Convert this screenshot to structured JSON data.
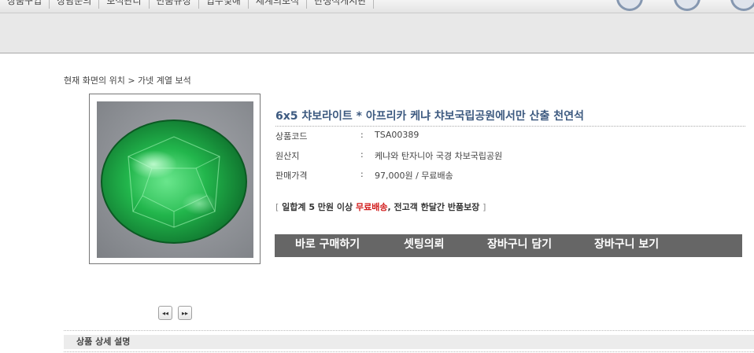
{
  "nav": {
    "items": [
      "상품구입",
      "상담문의",
      "보석관리",
      "반품규정",
      "입수및해",
      "세계의보석",
      "탄생석게시판"
    ]
  },
  "breadcrumb": "현재 화면의 위치 > 가넷 계열 보석",
  "product": {
    "title": "6x5 챠보라이트 * 아프리카 케냐 챠보국립공원에서만 산출 천연석",
    "fields": [
      {
        "label": "상품코드",
        "colon": ":",
        "value": "TSA00389"
      },
      {
        "label": "원산지",
        "colon": ":",
        "value": "케냐와 탄자니아 국경 차보국립공원"
      },
      {
        "label": "판매가격",
        "colon": ":",
        "value": "97,000원 / 무료배송"
      }
    ],
    "notice": {
      "open": "[",
      "part1": " 일합계 5 만원 이상 ",
      "free": "무료배송",
      "part2": ",   전고객 한달간 반품보장 ",
      "close": "]"
    },
    "image_alt": "green tsavorite gemstone"
  },
  "actions": {
    "buy": "바로 구매하기",
    "setting": "셋팅의뢰",
    "cart_add": "장바구니 담기",
    "cart_view": "장바구니 보기"
  },
  "gallery": {
    "prev": "◂◂",
    "next": "▸▸"
  },
  "detail": {
    "heading": "상품 상세 설명"
  },
  "colors": {
    "title": "#3d5a80",
    "button_bar": "#666666",
    "highlight": "#d11a1a",
    "gem": "#1fa843"
  }
}
